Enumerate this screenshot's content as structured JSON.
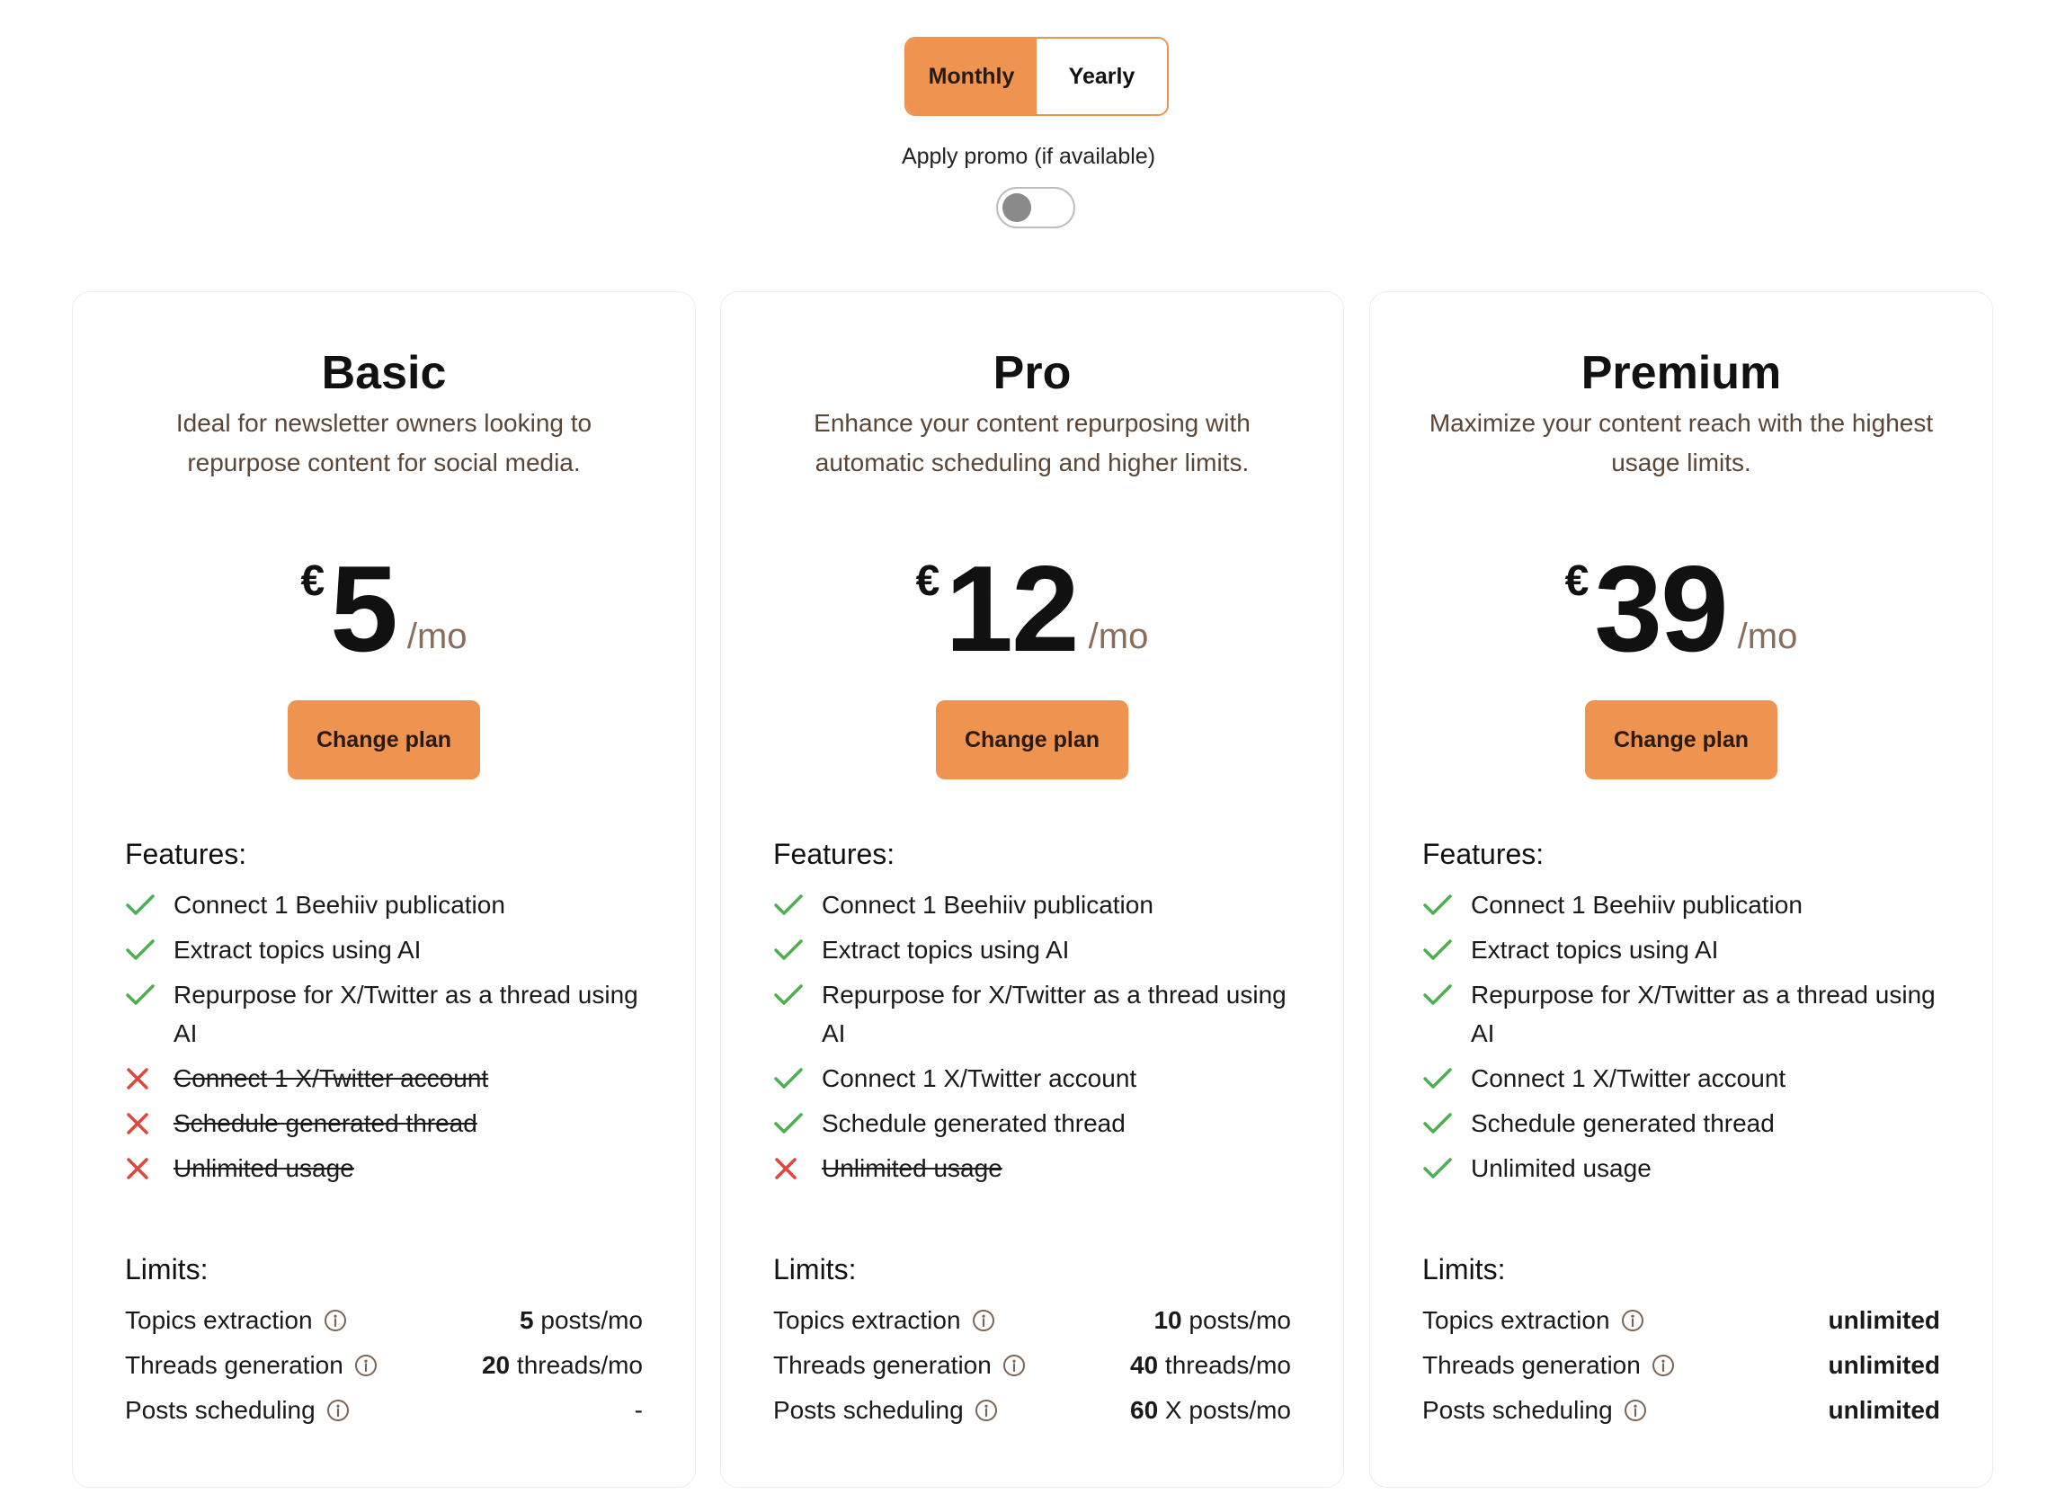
{
  "billing": {
    "monthly": "Monthly",
    "yearly": "Yearly"
  },
  "promo": {
    "label": "Apply promo (if available)",
    "enabled": false
  },
  "labels": {
    "features": "Features:",
    "limits": "Limits:",
    "per": "/mo",
    "currency": "€",
    "change_plan": "Change plan"
  },
  "colors": {
    "accent": "#ee9350",
    "check": "#4caf50",
    "cross": "#e0463a"
  },
  "plans": [
    {
      "name": "Basic",
      "description": "Ideal for newsletter owners looking to repurpose content for social media.",
      "price": "5",
      "features": [
        {
          "text": "Connect 1 Beehiiv publication",
          "included": true
        },
        {
          "text": "Extract topics using AI",
          "included": true
        },
        {
          "text": "Repurpose for X/Twitter as a thread using AI",
          "included": true
        },
        {
          "text": "Connect 1 X/Twitter account",
          "included": false
        },
        {
          "text": "Schedule generated thread",
          "included": false
        },
        {
          "text": "Unlimited usage",
          "included": false
        }
      ],
      "limits": [
        {
          "label": "Topics extraction",
          "value_bold": "5",
          "value_rest": " posts/mo"
        },
        {
          "label": "Threads generation",
          "value_bold": "20",
          "value_rest": " threads/mo"
        },
        {
          "label": "Posts scheduling",
          "value_bold": "",
          "value_rest": "-"
        }
      ]
    },
    {
      "name": "Pro",
      "description": "Enhance your content repurposing with automatic scheduling and higher limits.",
      "price": "12",
      "features": [
        {
          "text": "Connect 1 Beehiiv publication",
          "included": true
        },
        {
          "text": "Extract topics using AI",
          "included": true
        },
        {
          "text": "Repurpose for X/Twitter as a thread using AI",
          "included": true
        },
        {
          "text": "Connect 1 X/Twitter account",
          "included": true
        },
        {
          "text": "Schedule generated thread",
          "included": true
        },
        {
          "text": "Unlimited usage",
          "included": false
        }
      ],
      "limits": [
        {
          "label": "Topics extraction",
          "value_bold": "10",
          "value_rest": " posts/mo"
        },
        {
          "label": "Threads generation",
          "value_bold": "40",
          "value_rest": " threads/mo"
        },
        {
          "label": "Posts scheduling",
          "value_bold": "60",
          "value_rest": " X posts/mo"
        }
      ]
    },
    {
      "name": "Premium",
      "description": "Maximize your content reach with the highest usage limits.",
      "price": "39",
      "features": [
        {
          "text": "Connect 1 Beehiiv publication",
          "included": true
        },
        {
          "text": "Extract topics using AI",
          "included": true
        },
        {
          "text": "Repurpose for X/Twitter as a thread using AI",
          "included": true
        },
        {
          "text": "Connect 1 X/Twitter account",
          "included": true
        },
        {
          "text": "Schedule generated thread",
          "included": true
        },
        {
          "text": "Unlimited usage",
          "included": true
        }
      ],
      "limits": [
        {
          "label": "Topics extraction",
          "value_bold": "unlimited",
          "value_rest": ""
        },
        {
          "label": "Threads generation",
          "value_bold": "unlimited",
          "value_rest": ""
        },
        {
          "label": "Posts scheduling",
          "value_bold": "unlimited",
          "value_rest": ""
        }
      ]
    }
  ]
}
